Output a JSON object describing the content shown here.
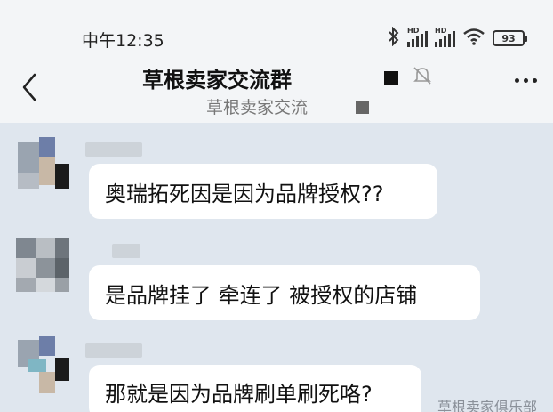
{
  "status_bar": {
    "time": "中午12:35",
    "battery": "93",
    "icons": [
      "bluetooth-icon",
      "hd-signal-icon",
      "hd-signal-icon",
      "wifi-icon",
      "battery-icon"
    ]
  },
  "header": {
    "title": "草根卖家交流群",
    "subtitle": "草根卖家交流",
    "back_icon": "chevron-left-icon",
    "mute_icon": "mute-bell-icon",
    "more_icon": "more-dots-icon"
  },
  "messages": [
    {
      "text": "奥瑞拓死因是因为品牌授权??"
    },
    {
      "text": "是品牌挂了 牵连了 被授权的店铺"
    },
    {
      "text": "那就是因为品牌刷单刷死咯?"
    }
  ],
  "watermark": "草根卖家俱乐部",
  "colors": {
    "header_bg": "#f3f5f7",
    "chat_bg": "#dfe6ee",
    "bubble_bg": "#ffffff"
  }
}
